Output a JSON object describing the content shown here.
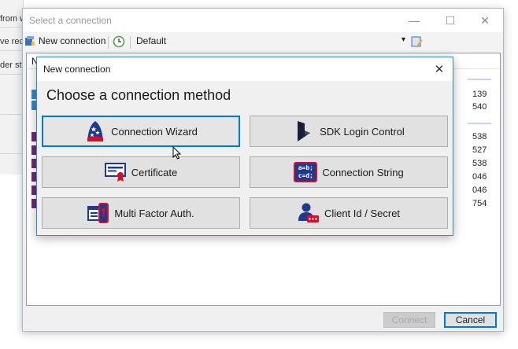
{
  "background": {
    "left_texts": [
      "from w",
      "ve rec",
      "der str"
    ]
  },
  "window": {
    "title": "Select a connection",
    "controls": {
      "minimize": "—",
      "maximize": "☐",
      "close": "✕"
    },
    "toolbar": {
      "new_connection_label": "New connection",
      "profile_label": "Default",
      "dropdown_arrow": "▾"
    },
    "list": {
      "header_first": "N",
      "numbers": [
        "139",
        "540",
        "538",
        "527",
        "538",
        "046",
        "046",
        "754"
      ]
    },
    "footer": {
      "connect_label": "Connect",
      "cancel_label": "Cancel"
    }
  },
  "dialog": {
    "title": "New connection",
    "close": "✕",
    "heading": "Choose a connection method",
    "buttons": [
      {
        "label": "Connection Wizard",
        "icon": "wizard-hat-icon"
      },
      {
        "label": "SDK Login Control",
        "icon": "dynamics-logo-icon"
      },
      {
        "label": "Certificate",
        "icon": "certificate-icon"
      },
      {
        "label": "Connection String",
        "icon": "connection-string-icon"
      },
      {
        "label": "Multi Factor Auth.",
        "icon": "multi-factor-icon"
      },
      {
        "label": "Client Id / Secret",
        "icon": "client-secret-icon"
      }
    ],
    "connection_string_icon_text": [
      "a=b;",
      "c=d;"
    ],
    "colors": {
      "accent": "#0078d7",
      "icon_red": "#d0102c",
      "icon_navy": "#1f3a8c"
    }
  }
}
